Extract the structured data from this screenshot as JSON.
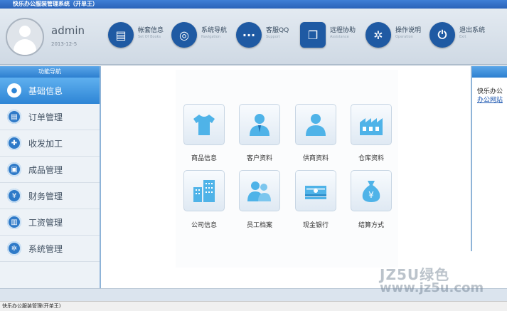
{
  "window": {
    "title": "快乐办公服装管理系统（开单王）"
  },
  "header": {
    "user": "admin",
    "date": "2013-12-5",
    "tools": [
      {
        "label": "帐套信息",
        "sub": "Set Of Books",
        "icon": "ledger-icon",
        "glyph": "▤"
      },
      {
        "label": "系统导航",
        "sub": "Navigation",
        "icon": "compass-icon",
        "glyph": "◎"
      },
      {
        "label": "客服QQ",
        "sub": "Support",
        "icon": "chat-icon",
        "glyph": "···"
      },
      {
        "label": "远程协助",
        "sub": "Assistance",
        "icon": "remote-icon",
        "glyph": "❐"
      },
      {
        "label": "操作说明",
        "sub": "Operation",
        "icon": "gear-icon",
        "glyph": "✲"
      },
      {
        "label": "退出系统",
        "sub": "Exit",
        "icon": "power-icon",
        "glyph": "⏻"
      }
    ]
  },
  "sidebar": {
    "title": "功能导航",
    "items": [
      {
        "label": "基础信息",
        "icon": "user-circle-icon",
        "glyph": "●",
        "active": true
      },
      {
        "label": "订单管理",
        "icon": "order-icon",
        "glyph": "▤"
      },
      {
        "label": "收发加工",
        "icon": "process-icon",
        "glyph": "✚"
      },
      {
        "label": "成品管理",
        "icon": "box-icon",
        "glyph": "▣"
      },
      {
        "label": "财务管理",
        "icon": "yen-icon",
        "glyph": "¥"
      },
      {
        "label": "工资管理",
        "icon": "payroll-icon",
        "glyph": "▥"
      },
      {
        "label": "系统管理",
        "icon": "settings-icon",
        "glyph": "✲"
      }
    ]
  },
  "main": {
    "tiles": [
      {
        "label": "商品信息",
        "icon": "tshirt-icon"
      },
      {
        "label": "客户资料",
        "icon": "customer-icon"
      },
      {
        "label": "供商资料",
        "icon": "supplier-icon"
      },
      {
        "label": "仓库资料",
        "icon": "warehouse-icon"
      },
      {
        "label": "公司信息",
        "icon": "building-icon"
      },
      {
        "label": "员工档案",
        "icon": "staff-icon"
      },
      {
        "label": "现金银行",
        "icon": "cash-icon"
      },
      {
        "label": "结算方式",
        "icon": "moneybag-icon"
      }
    ]
  },
  "rightpanel": {
    "text": "快乐办公",
    "link": "办公网站"
  },
  "statusbar": {
    "text": "快乐办公服装管理(开单王)"
  },
  "watermark": {
    "line1": "JZ5U绿色",
    "line2": "www.jz5u.com"
  },
  "colors": {
    "accent": "#2f86d6",
    "icon_blue": "#4fb3e8",
    "header_bg": "#dbe4ee"
  }
}
